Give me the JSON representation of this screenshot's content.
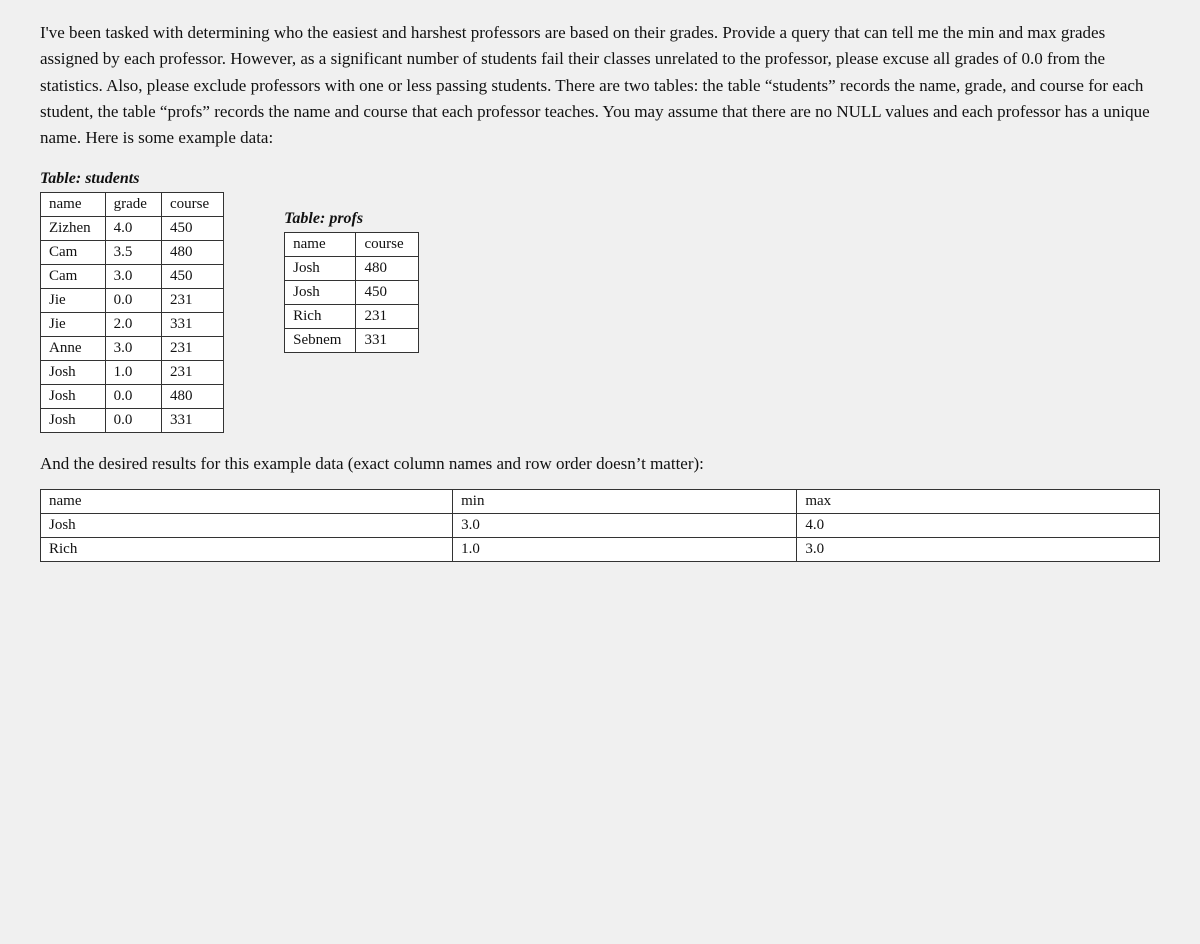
{
  "question": {
    "paragraph": "I've been tasked with determining who the easiest and harshest professors are based on their grades. Provide a query that can tell me the min and max grades assigned by each professor. However, as a significant number of students fail their classes unrelated to the professor, please excuse all grades of 0.0 from the statistics. Also, please exclude professors with one or less passing students. There are two tables: the table “students” records the name, grade, and course for each student, the table “profs” records the name and course that each professor teaches. You may assume that there are no NULL values and each professor has a unique name. Here is some example data:"
  },
  "students_table": {
    "label_prefix": "Table: ",
    "label_name": "students",
    "headers": [
      "name",
      "grade",
      "course"
    ],
    "rows": [
      [
        "Zizhen",
        "4.0",
        "450"
      ],
      [
        "Cam",
        "3.5",
        "480"
      ],
      [
        "Cam",
        "3.0",
        "450"
      ],
      [
        "Jie",
        "0.0",
        "231"
      ],
      [
        "Jie",
        "2.0",
        "331"
      ],
      [
        "Anne",
        "3.0",
        "231"
      ],
      [
        "Josh",
        "1.0",
        "231"
      ],
      [
        "Josh",
        "0.0",
        "480"
      ],
      [
        "Josh",
        "0.0",
        "331"
      ]
    ]
  },
  "profs_table": {
    "label_prefix": "Table: ",
    "label_name": "profs",
    "headers": [
      "name",
      "course"
    ],
    "rows": [
      [
        "Josh",
        "480"
      ],
      [
        "Josh",
        "450"
      ],
      [
        "Rich",
        "231"
      ],
      [
        "Sebnem",
        "331"
      ]
    ]
  },
  "and_text": "And the desired results for this example data (exact column names and row order doesn’t matter):",
  "results_table": {
    "headers": [
      "name",
      "min",
      "max"
    ],
    "rows": [
      [
        "Josh",
        "3.0",
        "4.0"
      ],
      [
        "Rich",
        "1.0",
        "3.0"
      ]
    ]
  }
}
